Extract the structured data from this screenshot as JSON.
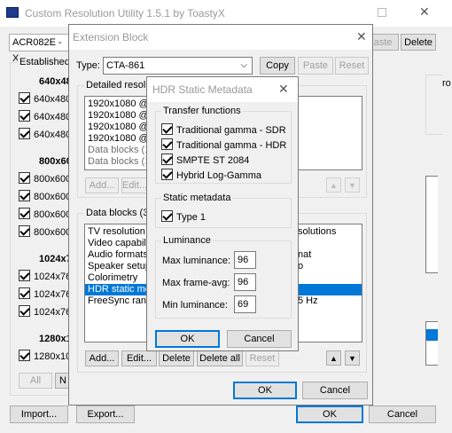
{
  "main": {
    "title": "Custom Resolution Utility 1.5.1 by ToastyX",
    "monitor": "ACR082E - X",
    "delete_label": "Delete",
    "paste_partial": "aste",
    "established_label": "Established",
    "groups": [
      {
        "header": "640x48",
        "items": [
          "640x480",
          "640x480",
          "640x480"
        ]
      },
      {
        "header": "800x60",
        "items": [
          "800x600",
          "800x600",
          "800x600",
          "800x600"
        ]
      },
      {
        "header": "1024x7",
        "items": [
          "1024x76",
          "1024x76",
          "1024x76"
        ]
      },
      {
        "header": "1280x1",
        "items": [
          "1280x10"
        ]
      }
    ],
    "all_label": "All",
    "no_label": "N",
    "import_label": "Import...",
    "export_label": "Export...",
    "ok_label": "OK",
    "cancel_label": "Cancel",
    "right_label": "ro"
  },
  "extension": {
    "title": "Extension Block",
    "type_label": "Type:",
    "type_value": "CTA-861",
    "copy_label": "Copy",
    "paste_label": "Paste",
    "reset_label": "Reset",
    "detailed_label": "Detailed resolu",
    "detailed_items": [
      {
        "text": "1920x1080 @",
        "gray": false
      },
      {
        "text": "1920x1080 @",
        "gray": false
      },
      {
        "text": "1920x1080 @",
        "gray": false
      },
      {
        "text": "1920x1080 @",
        "gray": false
      },
      {
        "text": "Data blocks (1",
        "gray": true
      },
      {
        "text": "Data blocks (1",
        "gray": true
      }
    ],
    "add_label": "Add...",
    "edit_label": "Edit...",
    "datablocks_label": "Data blocks (3",
    "datablock_items": [
      {
        "text": "TV resolution",
        "right": "solutions",
        "sel": false
      },
      {
        "text": "Video capabilit",
        "right": "",
        "sel": false
      },
      {
        "text": "Audio formats",
        "right": "nat",
        "sel": false
      },
      {
        "text": "Speaker setup",
        "right": "o",
        "sel": false
      },
      {
        "text": "Colorimetry",
        "right": "",
        "sel": false
      },
      {
        "text": "HDR static me",
        "right": "",
        "sel": true
      },
      {
        "text": "FreeSync rang",
        "right": "5 Hz",
        "sel": false
      }
    ],
    "delete_label": "Delete",
    "delete_all_label": "Delete all",
    "reset_label2": "Reset",
    "ok_label": "OK",
    "cancel_label": "Cancel"
  },
  "hdr": {
    "title": "HDR Static Metadata",
    "transfer_label": "Transfer functions",
    "transfer_items": [
      "Traditional gamma - SDR",
      "Traditional gamma - HDR",
      "SMPTE ST 2084",
      "Hybrid Log-Gamma"
    ],
    "static_label": "Static metadata",
    "static_item": "Type 1",
    "luminance_label": "Luminance",
    "max_lum_label": "Max luminance:",
    "max_lum_value": "96",
    "max_avg_label": "Max frame-avg:",
    "max_avg_value": "96",
    "min_lum_label": "Min luminance:",
    "min_lum_value": "69",
    "ok_label": "OK",
    "cancel_label": "Cancel"
  },
  "colors": {
    "accent": "#0078d7",
    "window_bg": "#f0f0f0"
  }
}
